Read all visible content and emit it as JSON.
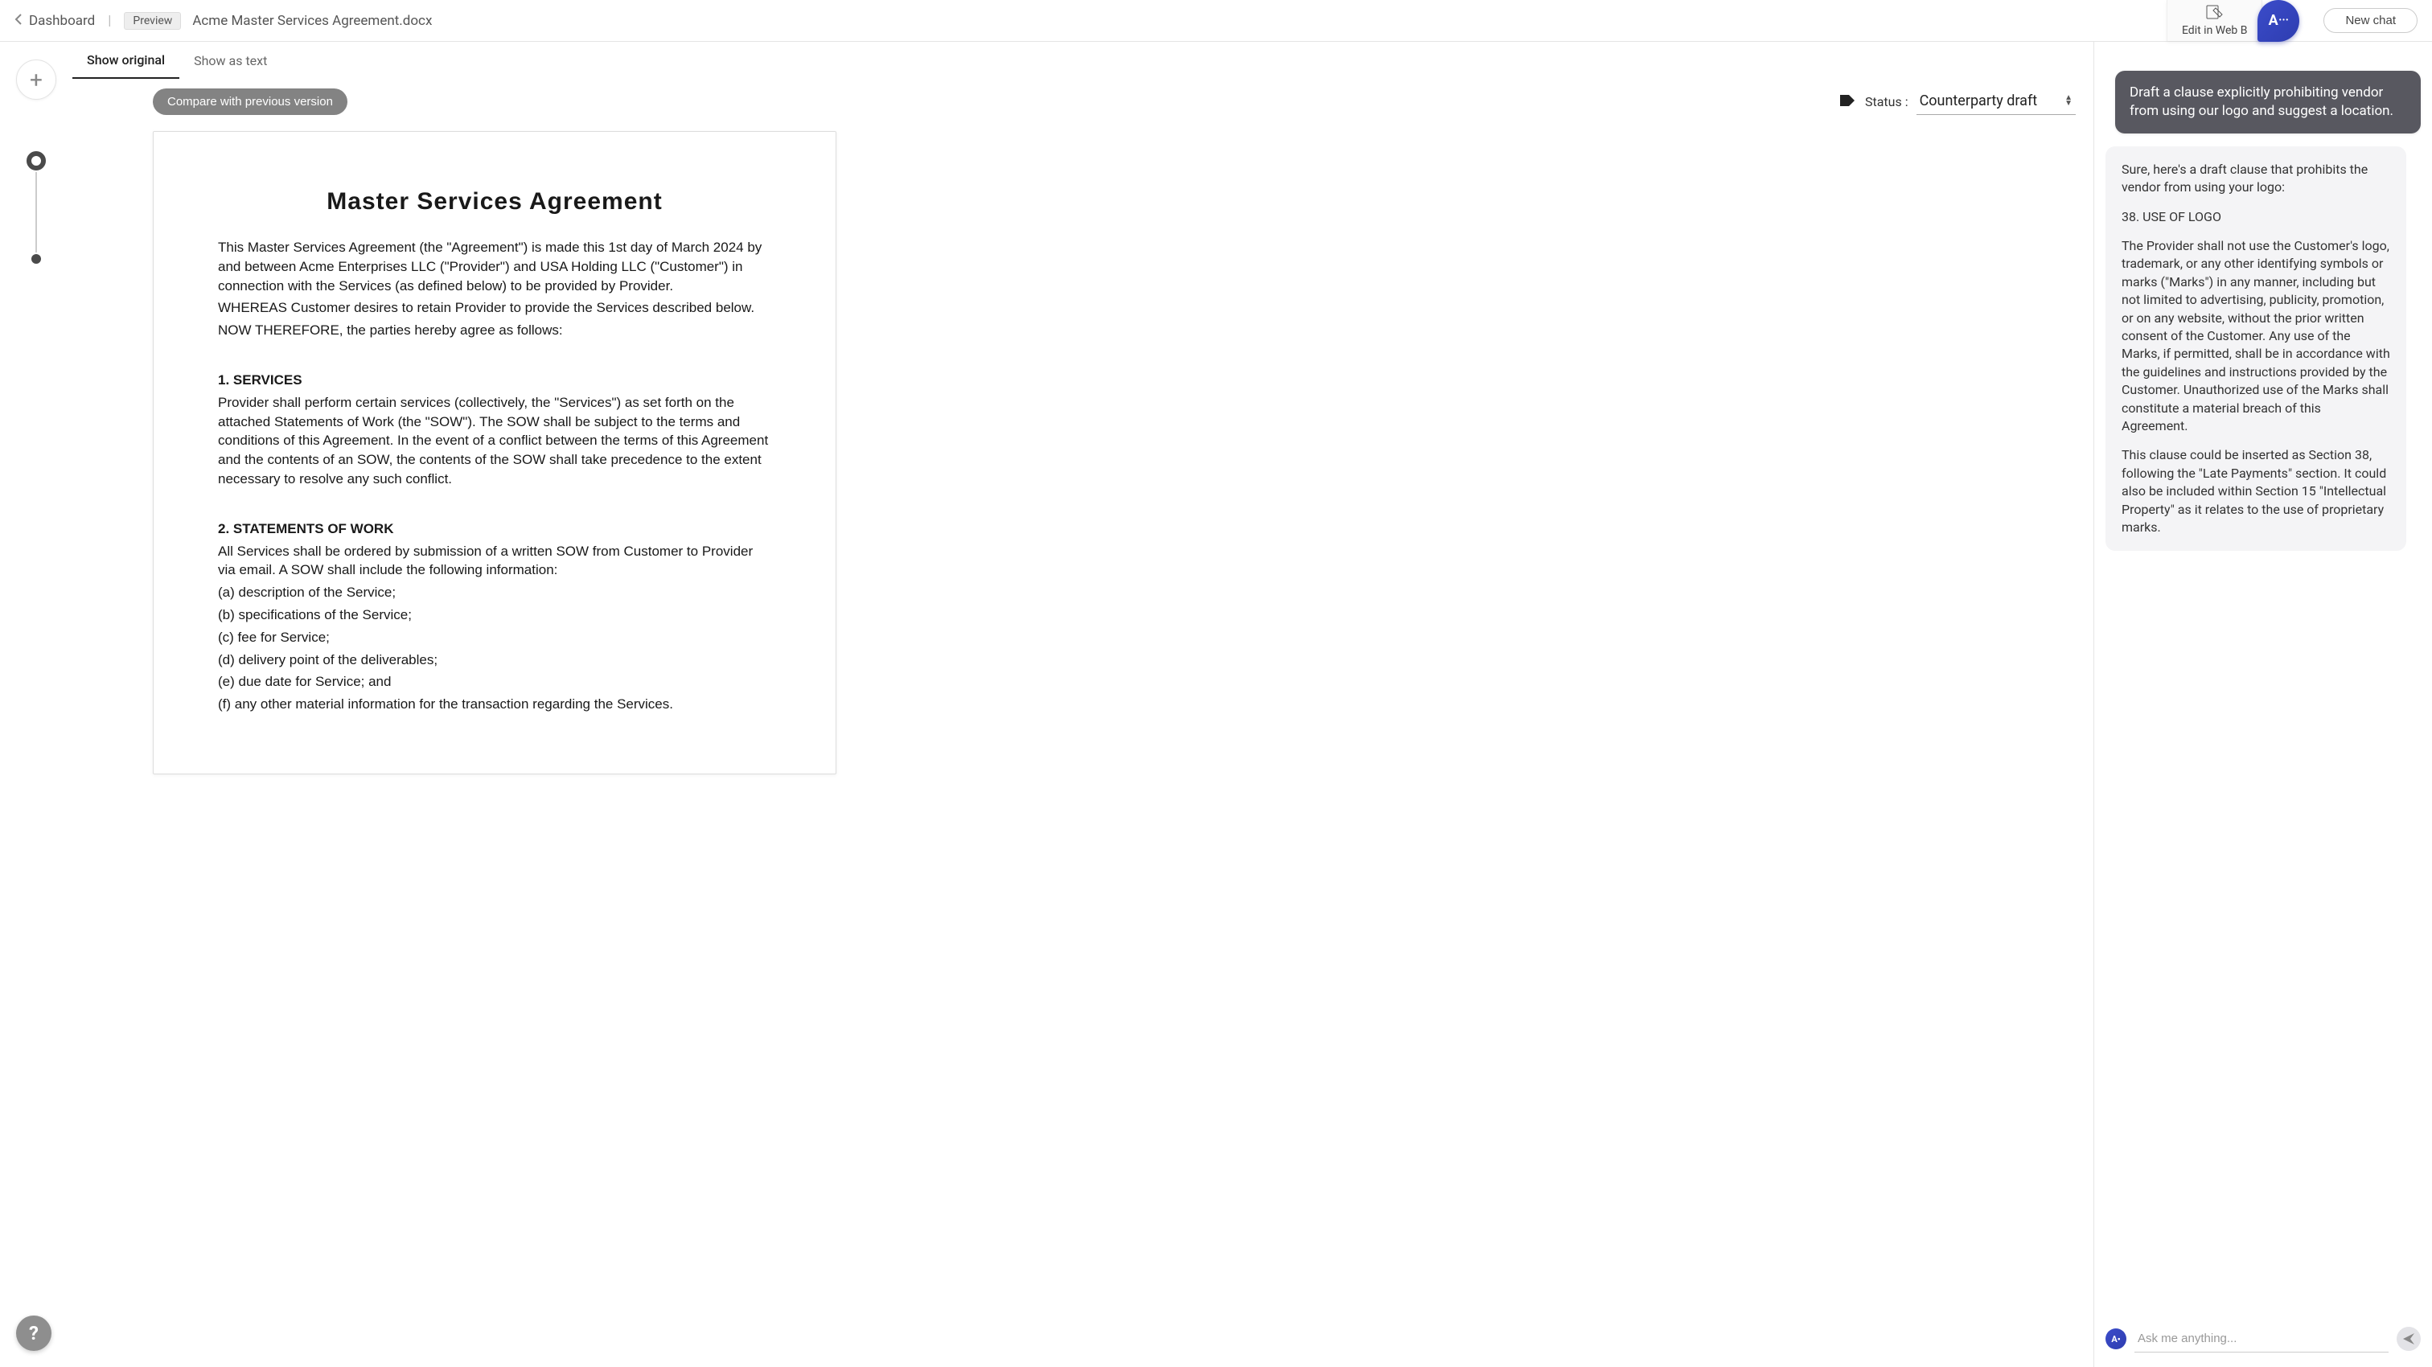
{
  "topbar": {
    "dashboard": "Dashboard",
    "preview_chip": "Preview",
    "doc_title": "Acme Master Services Agreement.docx",
    "edit_web": "Edit in Web B",
    "new_chat": "New chat"
  },
  "tabs": {
    "show_original": "Show original",
    "show_as_text": "Show as text"
  },
  "toolbar": {
    "compare": "Compare with previous version",
    "status_label": "Status :",
    "status_value": "Counterparty draft"
  },
  "document": {
    "title": "Master Services Agreement",
    "intro_1": "This Master Services Agreement (the \"Agreement\") is made this 1st day of March 2024 by and between Acme Enterprises LLC (\"Provider\") and USA Holding LLC (\"Customer\") in connection with the Services (as defined below) to be provided by Provider.",
    "intro_2": "WHEREAS Customer desires to retain Provider to provide the Services described below.",
    "intro_3": "NOW THEREFORE, the parties hereby agree as follows:",
    "sec1_title": "1. SERVICES",
    "sec1_body": "Provider shall perform certain services (collectively, the \"Services\") as set forth on the attached Statements of Work (the \"SOW\"). The SOW shall be subject to the terms and conditions of this Agreement. In the event of a conflict between the terms of this Agreement and the contents of an SOW, the contents of the SOW shall take precedence to the extent necessary to resolve any such conflict.",
    "sec2_title": "2. STATEMENTS OF WORK",
    "sec2_lead": "All Services shall be ordered by submission of a written SOW from Customer to Provider via email. A SOW shall include the following information:",
    "sec2_a": "(a) description of the Service;",
    "sec2_b": "(b) specifications of the Service;",
    "sec2_c": "(c) fee for Service;",
    "sec2_d": "(d) delivery point of the deliverables;",
    "sec2_e": "(e) due date for Service; and",
    "sec2_f": "(f) any other material information for the transaction regarding the Services."
  },
  "chat": {
    "user_msg": "Draft a clause explicitly prohibiting vendor from using our logo and suggest a location.",
    "ai_p1": "Sure, here's a draft clause that prohibits the vendor from using your logo:",
    "ai_p2": "38. USE OF LOGO",
    "ai_p3": "The Provider shall not use the Customer's logo, trademark, or any other identifying symbols or marks (\"Marks\") in any manner, including but not limited to advertising, publicity, promotion, or on any website, without the prior written consent of the Customer. Any use of the Marks, if permitted, shall be in accordance with the guidelines and instructions provided by the Customer. Unauthorized use of the Marks shall constitute a material breach of this Agreement.",
    "ai_p4": "This clause could be inserted as Section 38, following the \"Late Payments\" section. It could also be included within Section 15 \"Intellectual Property\" as it relates to the use of proprietary marks.",
    "input_placeholder": "Ask me anything..."
  },
  "help": "?"
}
